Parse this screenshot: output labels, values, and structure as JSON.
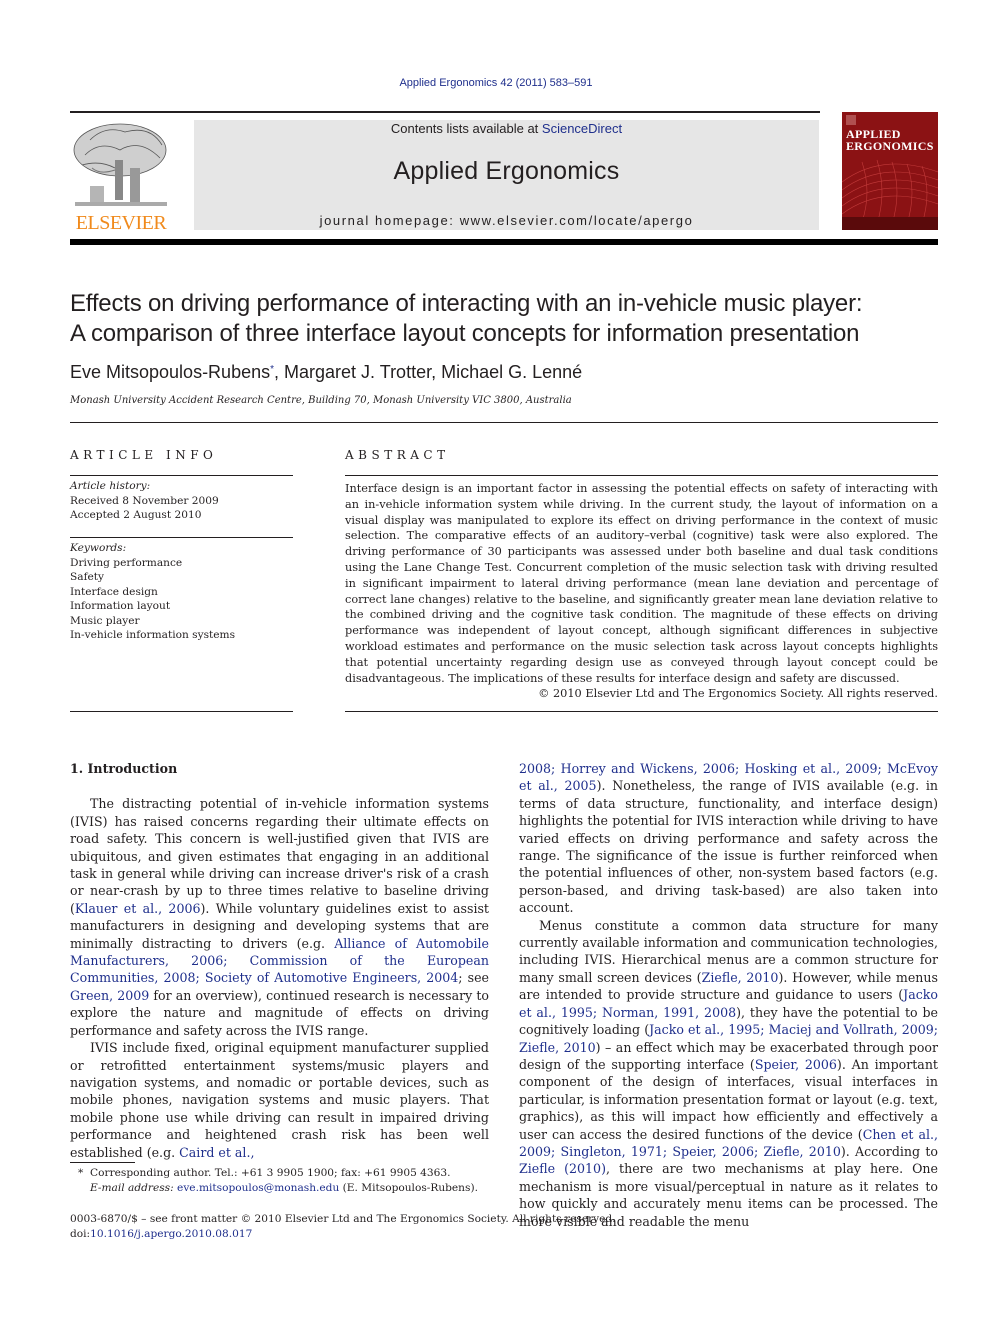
{
  "header": {
    "journal_reference": "Applied Ergonomics 42 (2011) 583–591",
    "contents_prefix": "Contents lists available at ",
    "contents_link": "ScienceDirect",
    "journal_name": "Applied Ergonomics",
    "homepage": "journal homepage: www.elsevier.com/locate/apergo",
    "publisher_logo_text": "ELSEVIER",
    "cover_title_line1": "APPLIED",
    "cover_title_line2": "ERGONOMICS",
    "colors": {
      "link": "#1f2f8c",
      "elsevier_orange": "#f08a1c",
      "cover_red": "#8b1214",
      "banner_gray": "#e6e6e6"
    }
  },
  "article": {
    "title_line1": "Effects on driving performance of interacting with an in-vehicle music player:",
    "title_line2": "A comparison of three interface layout concepts for information presentation",
    "authors": [
      {
        "name": "Eve Mitsopoulos-Rubens",
        "mark": "*"
      },
      {
        "name": "Margaret J. Trotter",
        "mark": ""
      },
      {
        "name": "Michael G. Lenné",
        "mark": ""
      }
    ],
    "affiliation": "Monash University Accident Research Centre, Building 70, Monash University VIC 3800, Australia"
  },
  "article_info": {
    "heading": "ARTICLE INFO",
    "history_label": "Article history:",
    "received": "Received 8 November 2009",
    "accepted": "Accepted 2 August 2010",
    "keywords_label": "Keywords:",
    "keywords": [
      "Driving performance",
      "Safety",
      "Interface design",
      "Information layout",
      "Music player",
      "In-vehicle information systems"
    ]
  },
  "abstract": {
    "heading": "ABSTRACT",
    "text": "Interface design is an important factor in assessing the potential effects on safety of interacting with an in-vehicle information system while driving. In the current study, the layout of information on a visual display was manipulated to explore its effect on driving performance in the context of music selection. The comparative effects of an auditory–verbal (cognitive) task were also explored. The driving performance of 30 participants was assessed under both baseline and dual task conditions using the Lane Change Test. Concurrent completion of the music selection task with driving resulted in significant impairment to lateral driving performance (mean lane deviation and percentage of correct lane changes) relative to the baseline, and significantly greater mean lane deviation relative to the combined driving and the cognitive task condition. The magnitude of these effects on driving performance was independent of layout concept, although significant differences in subjective workload estimates and performance on the music selection task across layout concepts highlights that potential uncertainty regarding design use as conveyed through layout concept could be disadvantageous. The implications of these results for interface design and safety are discussed.",
    "copyright": "© 2010 Elsevier Ltd and The Ergonomics Society. All rights reserved."
  },
  "body": {
    "section_heading": "1.  Introduction",
    "left_p1": [
      {
        "t": "The distracting potential of in-vehicle information systems (IVIS) has raised concerns regarding their ultimate effects on road safety. This concern is well-justified given that IVIS are ubiquitous, and given estimates that engaging in an additional task in general while driving can increase driver's risk of a crash or near-crash by up to three times relative to baseline driving ("
      },
      {
        "l": "Klauer et al., 2006"
      },
      {
        "t": "). While voluntary guidelines exist to assist manufacturers in designing and developing systems that are minimally distracting to drivers (e.g. "
      },
      {
        "l": "Alliance of Automobile Manufacturers, 2006; Commission of the European Communities, 2008; Society of Automotive Engineers, 2004"
      },
      {
        "t": "; see "
      },
      {
        "l": "Green, 2009"
      },
      {
        "t": " for an overview), continued research is necessary to explore the nature and magnitude of effects on driving performance and safety across the IVIS range."
      }
    ],
    "left_p2": [
      {
        "t": "IVIS include fixed, original equipment manufacturer supplied or retrofitted entertainment systems/music players and navigation systems, and nomadic or portable devices, such as mobile phones, navigation systems and music players. That mobile phone use while driving can result in impaired driving performance and heightened crash risk has been well established (e.g. "
      },
      {
        "l": "Caird et al.,"
      }
    ],
    "right_p1": [
      {
        "l": "2008; Horrey and Wickens, 2006; Hosking et al., 2009; McEvoy et al., 2005"
      },
      {
        "t": "). Nonetheless, the range of IVIS available (e.g. in terms of data structure, functionality, and interface design) highlights the potential for IVIS interaction while driving to have varied effects on driving performance and safety across the range. The significance of the issue is further reinforced when the potential influences of other, non-system based factors (e.g. person-based, and driving task-based) are also taken into account."
      }
    ],
    "right_p2": [
      {
        "t": "Menus constitute a common data structure for many currently available information and communication technologies, including IVIS. Hierarchical menus are a common structure for many small screen devices ("
      },
      {
        "l": "Ziefle, 2010"
      },
      {
        "t": "). However, while menus are intended to provide structure and guidance to users ("
      },
      {
        "l": "Jacko et al., 1995; Norman, 1991, 2008"
      },
      {
        "t": "), they have the potential to be cognitively loading ("
      },
      {
        "l": "Jacko et al., 1995; Maciej and Vollrath, 2009; Ziefle, 2010"
      },
      {
        "t": ") – an effect which may be exacerbated through poor design of the supporting interface ("
      },
      {
        "l": "Speier, 2006"
      },
      {
        "t": "). An important component of the design of interfaces, visual interfaces in particular, is information presentation format or layout (e.g. text, graphics), as this will impact how efficiently and effectively a user can access the desired functions of the device ("
      },
      {
        "l": "Chen et al., 2009; Singleton, 1971; Speier, 2006; Ziefle, 2010"
      },
      {
        "t": "). According to "
      },
      {
        "l": "Ziefle (2010)"
      },
      {
        "t": ", there are two mechanisms at play here. One mechanism is more visual/perceptual in nature as it relates to how quickly and accurately menu items can be processed. The more visible and readable the menu"
      }
    ]
  },
  "footnote": {
    "mark": "*",
    "line1": "Corresponding author. Tel.: +61 3 9905 1900; fax: +61 9905 4363.",
    "email_label": "E-mail address: ",
    "email": "eve.mitsopoulos@monash.edu",
    "email_suffix": " (E. Mitsopoulos-Rubens)."
  },
  "bottom": {
    "issn_line": "0003-6870/$ – see front matter © 2010 Elsevier Ltd and The Ergonomics Society. All rights reserved.",
    "doi_label": "doi:",
    "doi": "10.1016/j.apergo.2010.08.017"
  }
}
